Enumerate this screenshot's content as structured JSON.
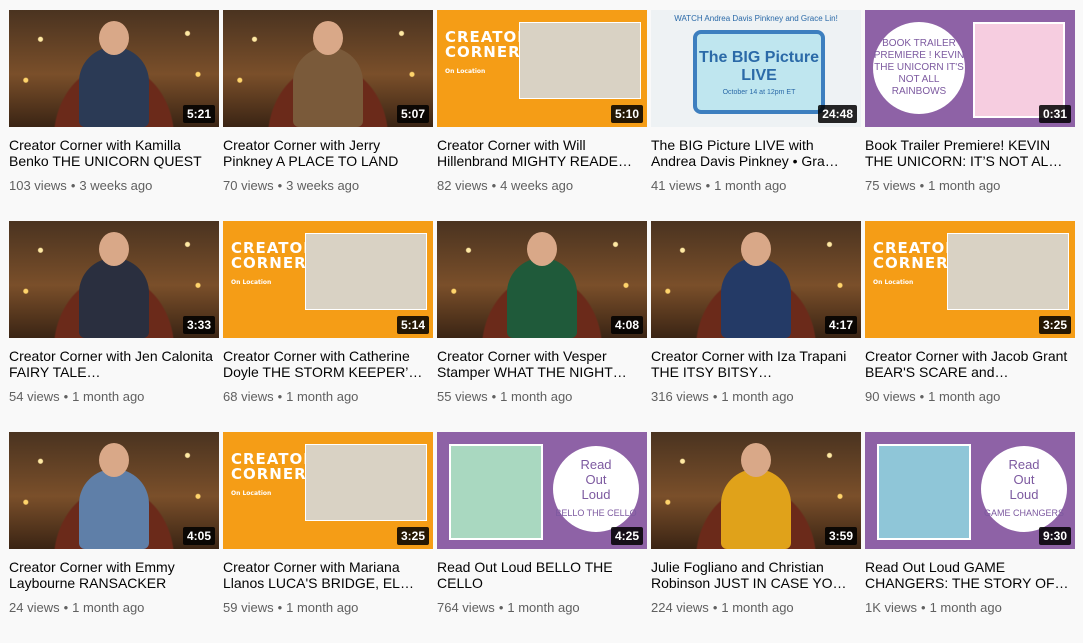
{
  "videos": [
    {
      "title": "Creator Corner with Kamilla Benko THE UNICORN QUEST",
      "views": "103 views",
      "age": "3 weeks ago",
      "duration": "5:21",
      "thumb": "cozy",
      "shirt": "#2b3a55"
    },
    {
      "title": "Creator Corner with Jerry Pinkney A PLACE TO LAND",
      "views": "70 views",
      "age": "3 weeks ago",
      "duration": "5:07",
      "thumb": "cozy",
      "shirt": "#7a5a3a"
    },
    {
      "title": "Creator Corner with Will Hillenbrand MIGHTY READE…",
      "views": "82 views",
      "age": "4 weeks ago",
      "duration": "5:10",
      "thumb": "creator-corner"
    },
    {
      "title": "The BIG Picture LIVE with Andrea Davis Pinkney • Gra…",
      "views": "41 views",
      "age": "1 month ago",
      "duration": "24:48",
      "thumb": "big-picture"
    },
    {
      "title": "Book Trailer Premiere! KEVIN THE UNICORN: IT’S NOT AL…",
      "views": "75 views",
      "age": "1 month ago",
      "duration": "0:31",
      "thumb": "trailer"
    },
    {
      "title": "Creator Corner with Jen Calonita FAIRY TALE…",
      "views": "54 views",
      "age": "1 month ago",
      "duration": "3:33",
      "thumb": "cozy",
      "shirt": "#2a2f3f"
    },
    {
      "title": "Creator Corner with Catherine Doyle THE STORM KEEPER’…",
      "views": "68 views",
      "age": "1 month ago",
      "duration": "5:14",
      "thumb": "creator-corner"
    },
    {
      "title": "Creator Corner with Vesper Stamper WHAT THE NIGHT…",
      "views": "55 views",
      "age": "1 month ago",
      "duration": "4:08",
      "thumb": "cozy",
      "shirt": "#1f5a3a"
    },
    {
      "title": "Creator Corner with Iza Trapani THE ITSY BITSY…",
      "views": "316 views",
      "age": "1 month ago",
      "duration": "4:17",
      "thumb": "cozy",
      "shirt": "#243a66"
    },
    {
      "title": "Creator Corner with Jacob Grant BEAR'S SCARE and…",
      "views": "90 views",
      "age": "1 month ago",
      "duration": "3:25",
      "thumb": "creator-corner"
    },
    {
      "title": "Creator Corner with Emmy Laybourne RANSACKER",
      "views": "24 views",
      "age": "1 month ago",
      "duration": "4:05",
      "thumb": "cozy",
      "shirt": "#5f7fa8"
    },
    {
      "title": "Creator Corner with Mariana Llanos LUCA'S BRIDGE, EL…",
      "views": "59 views",
      "age": "1 month ago",
      "duration": "3:25",
      "thumb": "creator-corner"
    },
    {
      "title": "Read Out Loud BELLO THE CELLO",
      "views": "764 views",
      "age": "1 month ago",
      "duration": "4:25",
      "thumb": "read-out-loud",
      "book": "#a9d8c0"
    },
    {
      "title": "Julie Fogliano and Christian Robinson JUST IN CASE YO…",
      "views": "224 views",
      "age": "1 month ago",
      "duration": "3:59",
      "thumb": "cozy",
      "shirt": "#e0a21a"
    },
    {
      "title": "Read Out Loud GAME CHANGERS: THE STORY OF…",
      "views": "1K views",
      "age": "1 month ago",
      "duration": "9:30",
      "thumb": "read-out-loud",
      "book": "#8fc6d8"
    }
  ],
  "thumb_text": {
    "creator_corner": "CREATOR CORNER",
    "on_location": "On Location",
    "big_picture_header": "WATCH Andrea Davis Pinkney and Grace Lin!",
    "big_picture": "The BIG Picture LIVE",
    "big_picture_date": "October 14 at 12pm ET",
    "trailer": "BOOK TRAILER PREMIERE ! KEVIN THE UNICORN IT'S NOT ALL RAINBOWS",
    "read_out_loud": "Read Out Loud",
    "bello": "BELLO THE CELLO",
    "game_changers": "GAME CHANGERS"
  }
}
